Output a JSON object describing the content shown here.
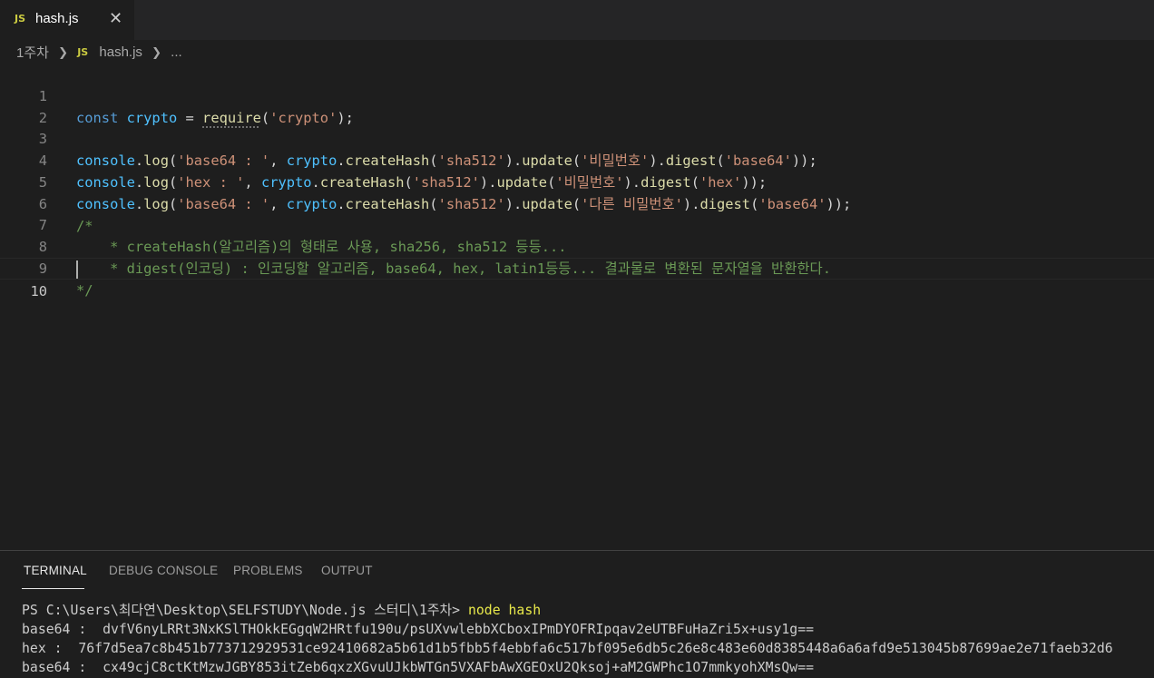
{
  "tab": {
    "icon": "javascript-file-icon",
    "icon_text": "JS",
    "label": "hash.js",
    "close": "✕"
  },
  "breadcrumb": {
    "folder": "1주차",
    "file": "hash.js",
    "more": "..."
  },
  "editor": {
    "lines": [
      {
        "n": "1"
      },
      {
        "n": "2"
      },
      {
        "n": "3"
      },
      {
        "n": "4"
      },
      {
        "n": "5"
      },
      {
        "n": "6"
      },
      {
        "n": "7"
      },
      {
        "n": "8"
      },
      {
        "n": "9"
      },
      {
        "n": "10"
      }
    ],
    "tokens": {
      "l1": [
        "const",
        "crypto",
        " = ",
        "require",
        "(",
        "'crypto'",
        ");"
      ],
      "l3": [
        "console",
        ".",
        "log",
        "(",
        "'base64 : '",
        ", ",
        "crypto",
        ".",
        "createHash",
        "(",
        "'sha512'",
        ").",
        "update",
        "(",
        "'비밀번호'",
        ").",
        "digest",
        "(",
        "'base64'",
        "));"
      ],
      "l4": [
        "console",
        ".",
        "log",
        "(",
        "'hex : '",
        ", ",
        "crypto",
        ".",
        "createHash",
        "(",
        "'sha512'",
        ").",
        "update",
        "(",
        "'비밀번호'",
        ").",
        "digest",
        "(",
        "'hex'",
        "));"
      ],
      "l5": [
        "console",
        ".",
        "log",
        "(",
        "'base64 : '",
        ", ",
        "crypto",
        ".",
        "createHash",
        "(",
        "'sha512'",
        ").",
        "update",
        "(",
        "'다른 비밀번호'",
        ").",
        "digest",
        "(",
        "'base64'",
        "));"
      ],
      "l6": "/*",
      "l7": "    * createHash(알고리즘)의 형태로 사용, sha256, sha512 등등...",
      "l8": "    * digest(인코딩) : 인코딩할 알고리즘, base64, hex, latin1등등... 결과물로 변환된 문자열을 반환한다.",
      "l9": "*/"
    }
  },
  "panel": {
    "tabs": [
      "TERMINAL",
      "DEBUG CONSOLE",
      "PROBLEMS",
      "OUTPUT"
    ],
    "terminal": {
      "prompt": "PS C:\\Users\\최다연\\Desktop\\SELFSTUDY\\Node.js 스터디\\1주차> ",
      "command": "node hash",
      "out1": "base64 :  dvfV6nyLRRt3NxKSlTHOkkEGgqW2HRtfu190u/psUXvwlebbXCboxIPmDYOFRIpqav2eUTBFuHaZri5x+usy1g==",
      "out2": "hex :  76f7d5ea7c8b451b773712929531ce92410682a5b61d1b5fbb5f4ebbfa6c517bf095e6db5c26e8c483e60d8385448a6a6afd9e513045b87699ae2e71faeb32d6",
      "out3": "base64 :  cx49cjC8ctKtMzwJGBY853itZeb6qxzXGvuUJkbWTGn5VXAFbAwXGEOxU2Qksoj+aM2GWPhc1O7mmkyohXMsQw=="
    }
  }
}
